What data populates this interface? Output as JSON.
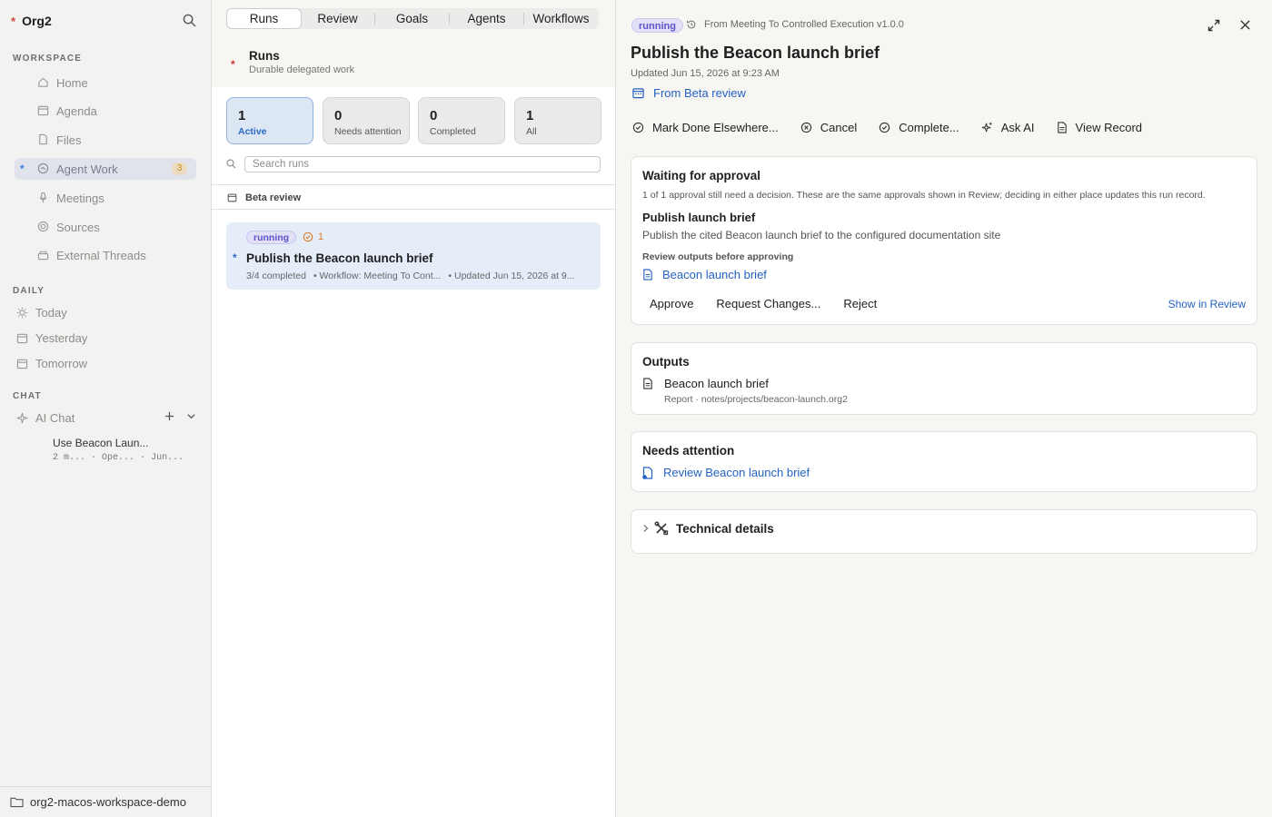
{
  "sidebar": {
    "org_name": "Org2",
    "workspace_label": "WORKSPACE",
    "workspace_items": [
      {
        "label": "Home",
        "icon": "home-icon"
      },
      {
        "label": "Agenda",
        "icon": "calendar-icon"
      },
      {
        "label": "Files",
        "icon": "file-icon"
      },
      {
        "label": "Agent Work",
        "icon": "agent-icon",
        "badge": "3",
        "active": true
      },
      {
        "label": "Meetings",
        "icon": "microphone-icon"
      },
      {
        "label": "Sources",
        "icon": "sources-icon"
      },
      {
        "label": "External Threads",
        "icon": "threads-icon"
      }
    ],
    "daily_label": "DAILY",
    "daily_items": [
      {
        "label": "Today",
        "icon": "sun-icon"
      },
      {
        "label": "Yesterday",
        "icon": "calendar-icon"
      },
      {
        "label": "Tomorrow",
        "icon": "calendar-icon"
      }
    ],
    "chat_label": "CHAT",
    "chat": {
      "ai_chat_label": "AI Chat",
      "thread_title": "Use Beacon Laun...",
      "thread_meta": [
        "2 m...",
        "·",
        "Ope...",
        "·",
        "Jun..."
      ]
    },
    "workspace_name": "org2-macos-workspace-demo"
  },
  "middle": {
    "tabs": [
      "Runs",
      "Review",
      "Goals",
      "Agents",
      "Workflows"
    ],
    "active_tab": "Runs",
    "header_title": "Runs",
    "header_subtitle": "Durable delegated work",
    "stats": [
      {
        "num": "1",
        "label": "Active",
        "active": true
      },
      {
        "num": "0",
        "label": "Needs attention"
      },
      {
        "num": "0",
        "label": "Completed"
      },
      {
        "num": "1",
        "label": "All"
      }
    ],
    "search_placeholder": "Search runs",
    "group_header": "Beta review",
    "run": {
      "status": "running",
      "attention_count": "1",
      "title": "Publish the Beacon launch brief",
      "meta": [
        "3/4 completed",
        "• Workflow: Meeting To Cont...",
        "• Updated Jun 15, 2026 at 9..."
      ]
    }
  },
  "detail": {
    "status": "running",
    "workflow": "From Meeting To Controlled Execution v1.0.0",
    "title": "Publish the Beacon launch brief",
    "updated": "Updated Jun 15, 2026 at 9:23 AM",
    "source_link": "From Beta review",
    "actions": [
      "Mark Done Elsewhere...",
      "Cancel",
      "Complete...",
      "Ask AI",
      "View Record"
    ],
    "approval": {
      "title": "Waiting for approval",
      "note": "1 of 1 approval still need a decision. These are the same approvals shown in Review; deciding in either place updates this run record.",
      "item_title": "Publish launch brief",
      "item_desc": "Publish the cited Beacon launch brief to the configured documentation site",
      "review_label": "Review outputs before approving",
      "output_link": "Beacon launch brief",
      "buttons": [
        "Approve",
        "Request Changes...",
        "Reject"
      ],
      "show_in_review": "Show in Review"
    },
    "outputs": {
      "title": "Outputs",
      "name": "Beacon launch brief",
      "meta": "Report · notes/projects/beacon-launch.org2"
    },
    "needs_attention": {
      "title": "Needs attention",
      "link": "Review Beacon launch brief"
    },
    "technical": {
      "title": "Technical details"
    }
  }
}
